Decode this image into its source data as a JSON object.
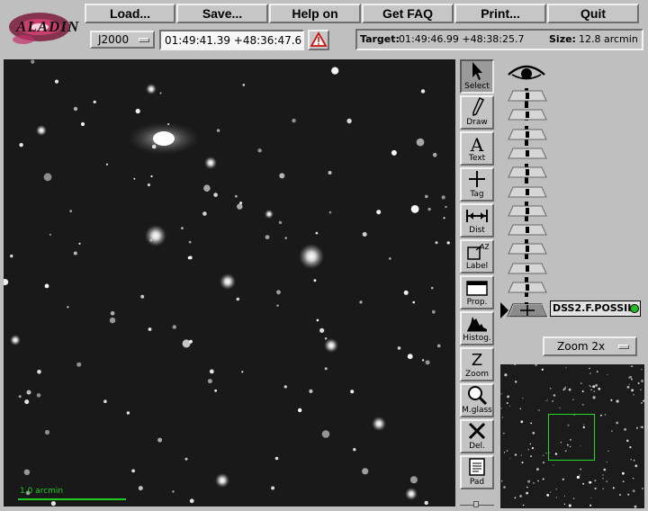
{
  "app": {
    "logo_text": "ALADIN"
  },
  "menu": [
    {
      "label": "Load..."
    },
    {
      "label": "Save..."
    },
    {
      "label": "Help on"
    },
    {
      "label": "Get FAQ"
    },
    {
      "label": "Print..."
    },
    {
      "label": "Quit"
    }
  ],
  "coords": {
    "frame": "J2000",
    "position": "01:49:41.39 +48:36:47.6"
  },
  "info": {
    "target_label": "Target:",
    "target_value": "01:49:46.99 +48:38:25.7",
    "size_label": "Size:",
    "size_value": "12.8 arcmin"
  },
  "image": {
    "scale_label": "1.0 arcmin"
  },
  "tools": [
    {
      "label": "Select",
      "icon": "arrow-icon"
    },
    {
      "label": "Draw",
      "icon": "pencil-icon"
    },
    {
      "label": "Text",
      "icon": "letter-a-icon"
    },
    {
      "label": "Tag",
      "icon": "plus-icon"
    },
    {
      "label": "Dist",
      "icon": "distance-icon"
    },
    {
      "label": "Label",
      "icon": "label-icon"
    },
    {
      "label": "Prop.",
      "icon": "window-icon"
    },
    {
      "label": "Histog.",
      "icon": "histogram-icon"
    },
    {
      "label": "Zoom",
      "icon": "letter-z-icon"
    },
    {
      "label": "M.glass",
      "icon": "magnifier-icon"
    },
    {
      "label": "Del.",
      "icon": "x-icon"
    },
    {
      "label": "Pad",
      "icon": "notepad-icon"
    }
  ],
  "stack": {
    "plane_name": "DSS2.F.POSSII",
    "status_color": "#22c022"
  },
  "zoom": {
    "label": "Zoom 2x"
  },
  "colors": {
    "scale_bar": "#22cc22",
    "view_box": "#22dd22"
  }
}
